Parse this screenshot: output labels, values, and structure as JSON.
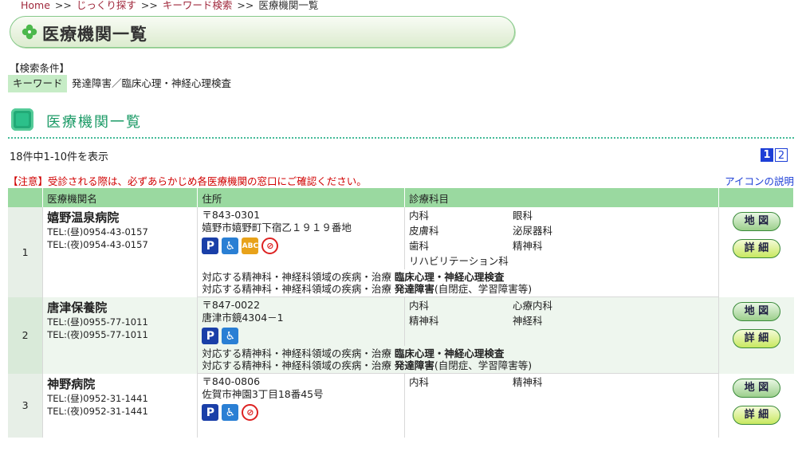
{
  "breadcrumb": {
    "home": "Home",
    "sep": ">>",
    "c1": "じっくり探す",
    "c2": "キーワード検索",
    "current": "医療機関一覧"
  },
  "page_title": "医療機関一覧",
  "search": {
    "label": "【検索条件】",
    "keyword_label": "キーワード",
    "keyword_value": "発達障害／臨床心理・神経心理検査"
  },
  "section_title": "医療機関一覧",
  "results": {
    "count_text": "18件中1-10件を表示",
    "pages": [
      "1",
      "2"
    ],
    "current_page": "1"
  },
  "notice": "【注意】受診される際は、必ずあらかじめ各医療機関の窓口にご確認ください。",
  "icon_help": "アイコンの説明",
  "columns": {
    "name": "医療機関名",
    "address": "住所",
    "depts": "診療科目"
  },
  "buttons": {
    "map": "地 図",
    "detail": "詳 細"
  },
  "disease_prefix": "対応する精神科・神経科領域の疾病・治療",
  "rows": [
    {
      "num": "1",
      "name": "嬉野温泉病院",
      "tel_day": "TEL:(昼)0954-43-0157",
      "tel_night": "TEL:(夜)0954-43-0157",
      "zip": "〒843-0301",
      "address": "嬉野市嬉野町下宿乙１９１９番地",
      "depts": [
        "内科",
        "眼科",
        "皮膚科",
        "泌尿器科",
        "歯科",
        "精神科",
        "リハビリテーション科"
      ],
      "d1": "臨床心理・神経心理検査",
      "d2": "発達障害",
      "d2_note": "(自閉症、学習障害等)"
    },
    {
      "num": "2",
      "name": "唐津保養院",
      "tel_day": "TEL:(昼)0955-77-1011",
      "tel_night": "TEL:(夜)0955-77-1011",
      "zip": "〒847-0022",
      "address": "唐津市鏡4304－1",
      "depts": [
        "内科",
        "心療内科",
        "精神科",
        "神経科"
      ],
      "d1": "臨床心理・神経心理検査",
      "d2": "発達障害",
      "d2_note": "(自閉症、学習障害等)"
    },
    {
      "num": "3",
      "name": "神野病院",
      "tel_day": "TEL:(昼)0952-31-1441",
      "tel_night": "TEL:(夜)0952-31-1441",
      "zip": "〒840-0806",
      "address": "佐賀市神園3丁目18番45号",
      "depts": [
        "内科",
        "精神科"
      ]
    }
  ],
  "icons": {
    "parking": "parking-icon",
    "wheelchair": "wheelchair-icon",
    "abc": "language-icon",
    "nosmoke": "no-smoking-icon"
  }
}
